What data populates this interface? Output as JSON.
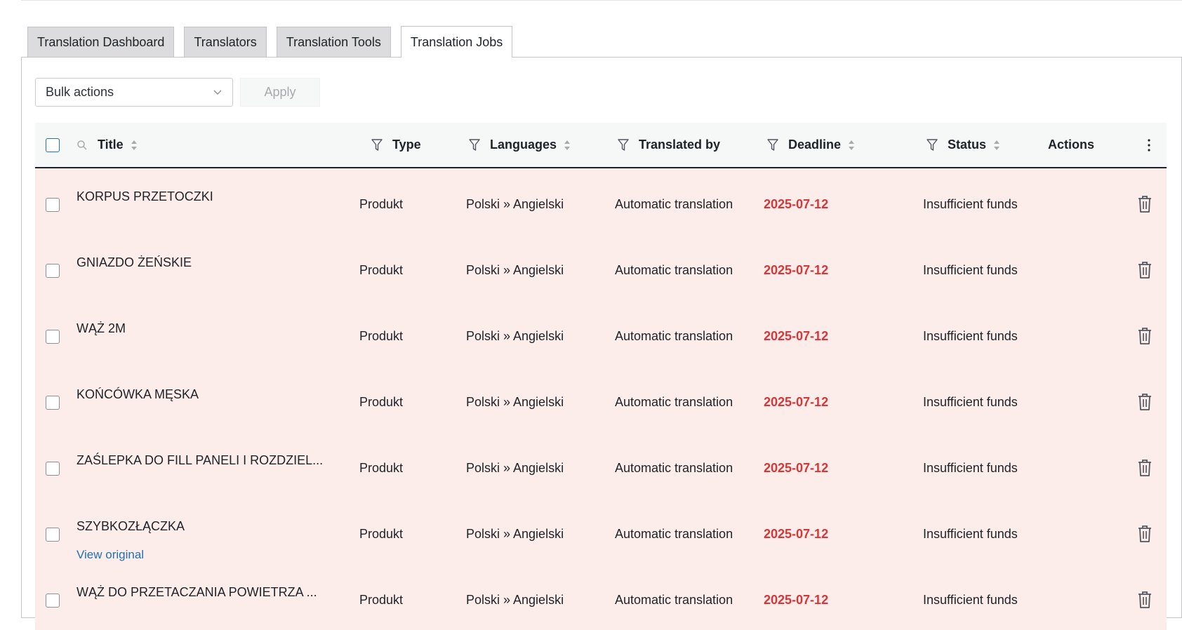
{
  "tabs": [
    {
      "label": "Translation Dashboard",
      "active": false
    },
    {
      "label": "Translators",
      "active": false
    },
    {
      "label": "Translation Tools",
      "active": false
    },
    {
      "label": "Translation Jobs",
      "active": true
    }
  ],
  "toolbar": {
    "bulk_actions": "Bulk actions",
    "apply": "Apply"
  },
  "columns": {
    "title": "Title",
    "type": "Type",
    "languages": "Languages",
    "translated_by": "Translated by",
    "deadline": "Deadline",
    "status": "Status",
    "actions": "Actions"
  },
  "rows": [
    {
      "title": "KORPUS PRZETOCZKI",
      "type": "Produkt",
      "languages": "Polski » Angielski",
      "translated_by": "Automatic translation",
      "deadline": "2025-07-12",
      "status": "Insufficient funds",
      "view_original": ""
    },
    {
      "title": "GNIAZDO ŻEŃSKIE",
      "type": "Produkt",
      "languages": "Polski » Angielski",
      "translated_by": "Automatic translation",
      "deadline": "2025-07-12",
      "status": "Insufficient funds",
      "view_original": ""
    },
    {
      "title": "WĄŻ 2M",
      "type": "Produkt",
      "languages": "Polski » Angielski",
      "translated_by": "Automatic translation",
      "deadline": "2025-07-12",
      "status": "Insufficient funds",
      "view_original": ""
    },
    {
      "title": "KOŃCÓWKA MĘSKA",
      "type": "Produkt",
      "languages": "Polski » Angielski",
      "translated_by": "Automatic translation",
      "deadline": "2025-07-12",
      "status": "Insufficient funds",
      "view_original": ""
    },
    {
      "title": "ZAŚLEPKA DO FILL PANELI I ROZDZIEL...",
      "type": "Produkt",
      "languages": "Polski » Angielski",
      "translated_by": "Automatic translation",
      "deadline": "2025-07-12",
      "status": "Insufficient funds",
      "view_original": ""
    },
    {
      "title": "SZYBKOZŁĄCZKA",
      "type": "Produkt",
      "languages": "Polski » Angielski",
      "translated_by": "Automatic translation",
      "deadline": "2025-07-12",
      "status": "Insufficient funds",
      "view_original": "View original"
    },
    {
      "title": "WĄŻ DO PRZETACZANIA POWIETRZA ...",
      "type": "Produkt",
      "languages": "Polski » Angielski",
      "translated_by": "Automatic translation",
      "deadline": "2025-07-12",
      "status": "Insufficient funds",
      "view_original": ""
    }
  ],
  "colors": {
    "row_background": "#fcecea",
    "deadline": "#d63638",
    "link": "#2271b1"
  }
}
